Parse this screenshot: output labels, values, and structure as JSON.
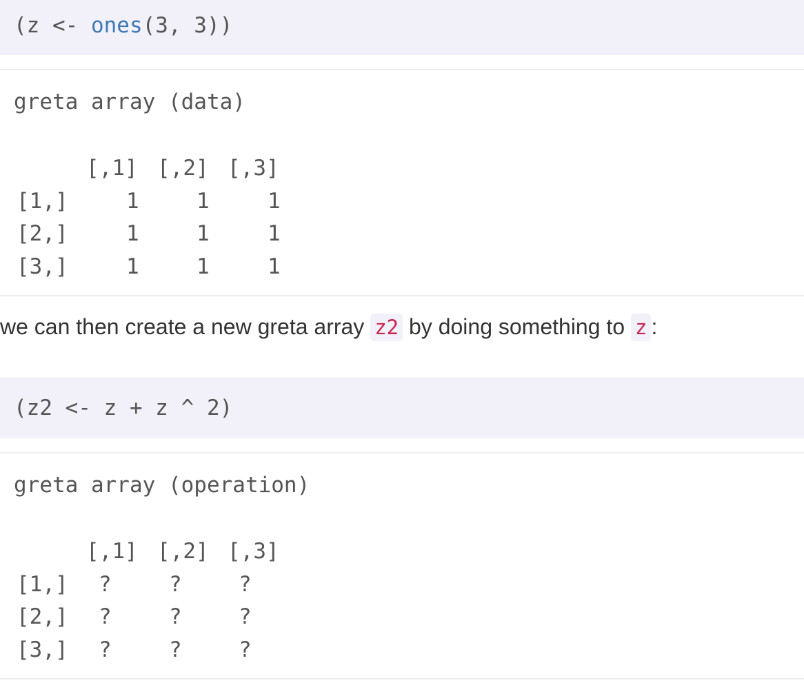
{
  "block1": {
    "code_open": "(z <- ",
    "code_fn": "ones",
    "code_rest": "(3, 3))",
    "out_title": "greta array (data)",
    "col_headers": [
      "[,1]",
      "[,2]",
      "[,3]"
    ],
    "rows": [
      {
        "label": "[1,]",
        "values": [
          "1",
          "1",
          "1"
        ]
      },
      {
        "label": "[2,]",
        "values": [
          "1",
          "1",
          "1"
        ]
      },
      {
        "label": "[3,]",
        "values": [
          "1",
          "1",
          "1"
        ]
      }
    ]
  },
  "paragraph": {
    "text1": "we can then create a new greta array ",
    "code1": "z2",
    "text2": " by doing something to ",
    "code2": "z",
    "text3": ":"
  },
  "block2": {
    "code": "(z2 <- z + z ^ 2)",
    "out_title": "greta array (operation)",
    "col_headers": [
      "[,1]",
      "[,2]",
      "[,3]"
    ],
    "rows": [
      {
        "label": "[1,]",
        "values": [
          "?",
          "?",
          "?"
        ]
      },
      {
        "label": "[2,]",
        "values": [
          "?",
          "?",
          "?"
        ]
      },
      {
        "label": "[3,]",
        "values": [
          "?",
          "?",
          "?"
        ]
      }
    ]
  }
}
